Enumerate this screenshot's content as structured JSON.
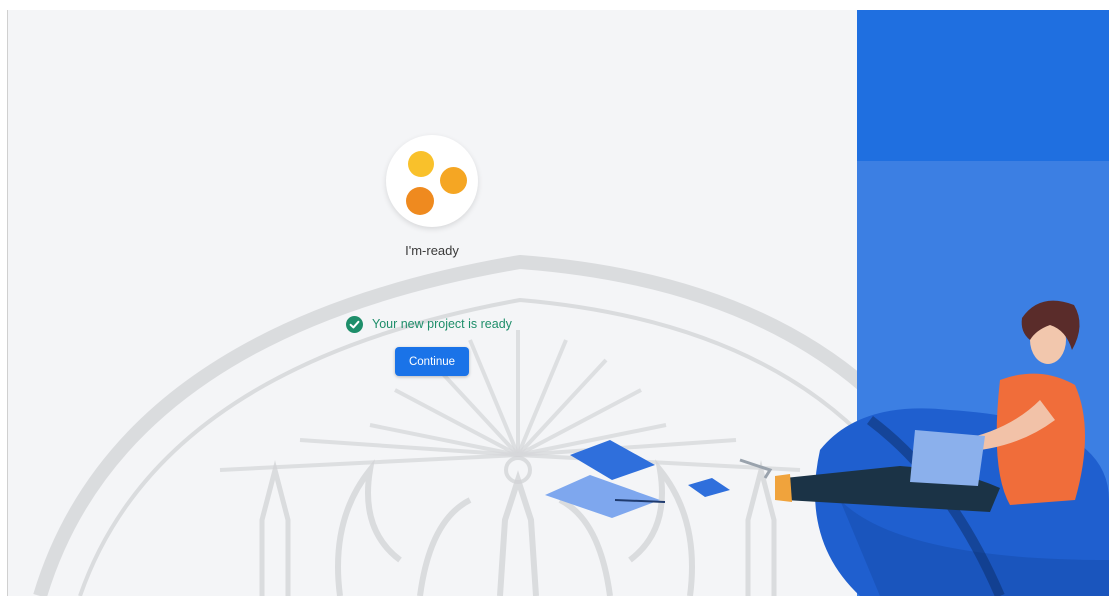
{
  "project": {
    "name": "I'm-ready",
    "logo_icon": "three-dots-logo-icon",
    "logo_colors": [
      "#f9c12b",
      "#f5a623",
      "#ef8a1f"
    ]
  },
  "status": {
    "message": "Your new project is ready",
    "icon": "check-circle-icon",
    "color": "#1e8e6a"
  },
  "actions": {
    "continue_label": "Continue",
    "accent_color": "#1a73e8"
  },
  "side_panel": {
    "background_color": "#3c7fe3",
    "illustration": "person-with-laptop-on-beanbag"
  }
}
